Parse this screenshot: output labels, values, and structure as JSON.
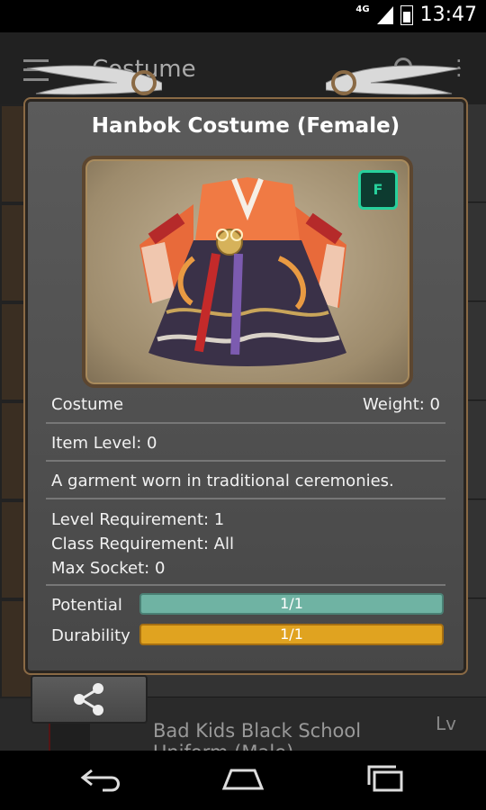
{
  "status_bar": {
    "network": "4G",
    "time": "13:47"
  },
  "app_bar": {
    "title": "Costume"
  },
  "background_list": {
    "item_name": "Bad Kids Black School",
    "item_name_second": "Uniform (Male)",
    "level_header": "Lv"
  },
  "item_panel": {
    "title": "Hanbok Costume (Female)",
    "badge": "F",
    "type": "Costume",
    "weight": "Weight: 0",
    "item_level": "Item Level: 0",
    "description": "A garment worn in traditional ceremonies.",
    "level_requirement": "Level Requirement: 1",
    "class_requirement": "Class Requirement: All",
    "max_socket": "Max Socket: 0",
    "potential": {
      "label": "Potential",
      "value": "1/1",
      "fraction": 1.0
    },
    "durability": {
      "label": "Durability",
      "value": "1/1",
      "fraction": 1.0
    }
  },
  "colors": {
    "potential_bar": "#6fb3a3",
    "durability_bar": "#e0a320",
    "badge_accent": "#27d19c"
  },
  "icons": [
    "share-icon",
    "back-icon",
    "home-icon",
    "recents-icon",
    "search-icon",
    "overflow-menu-icon",
    "hamburger-icon"
  ]
}
